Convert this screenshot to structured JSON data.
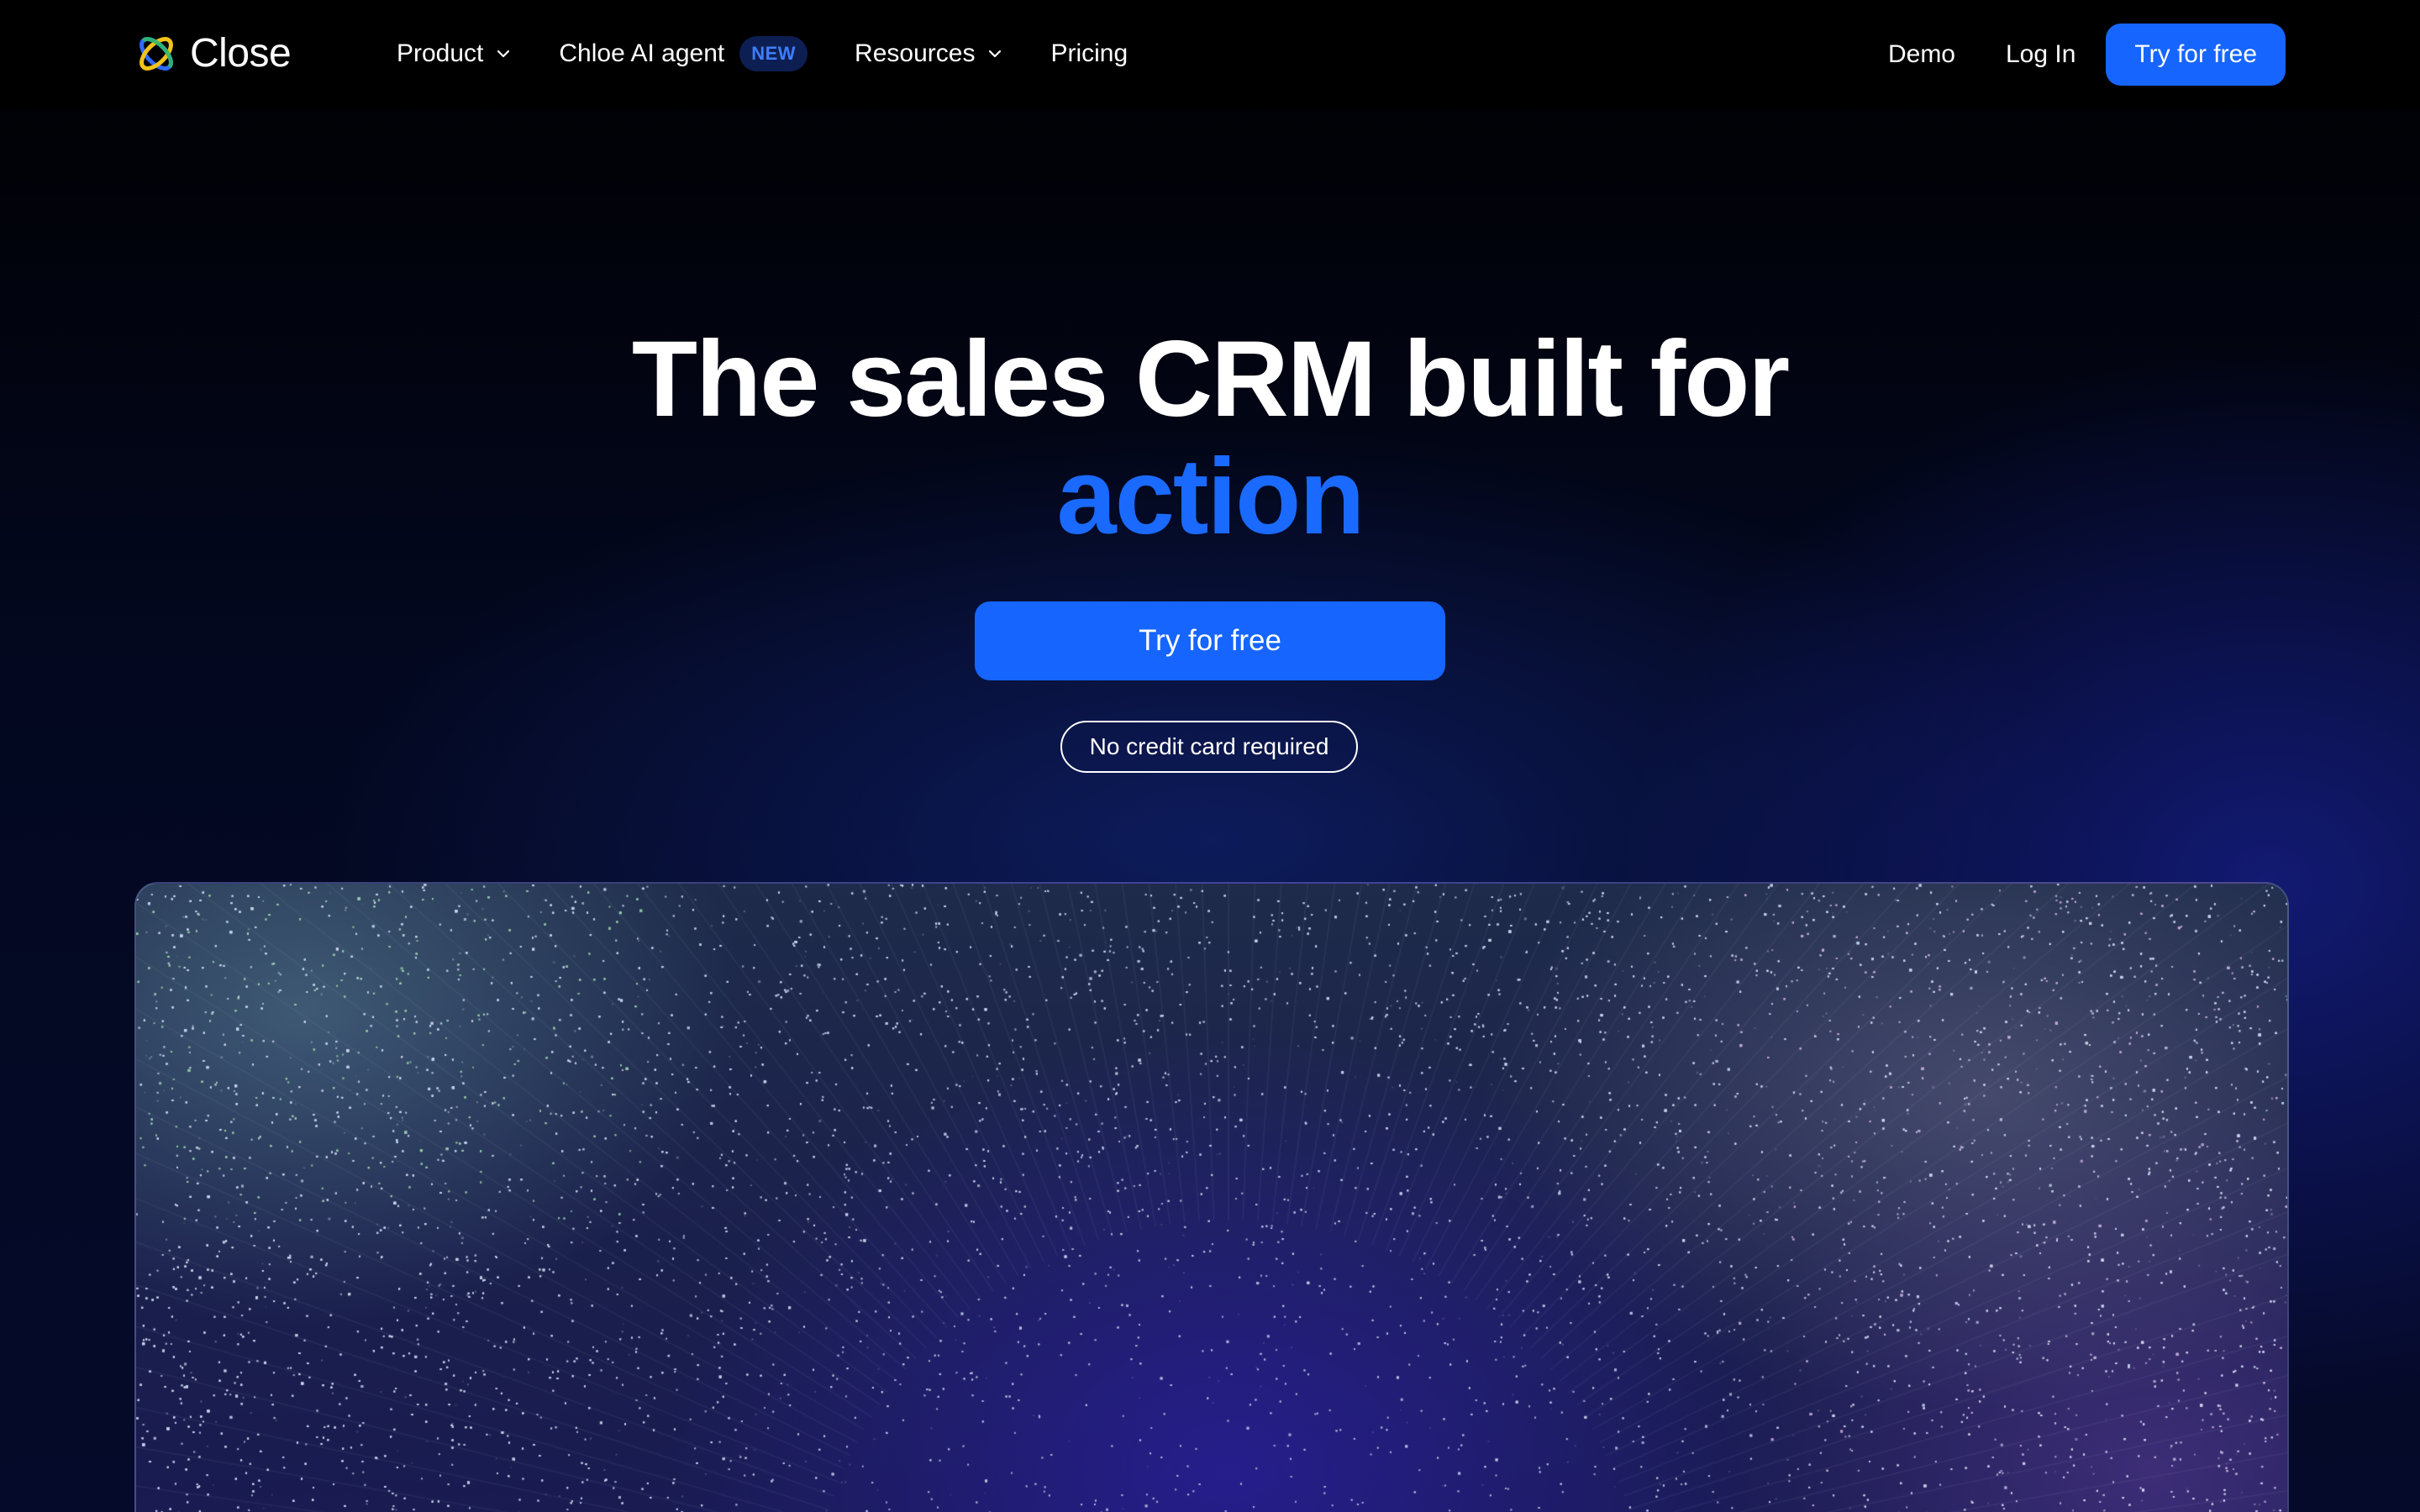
{
  "brand": {
    "name": "Close"
  },
  "nav": {
    "links": [
      {
        "label": "Product",
        "has_dropdown": true
      },
      {
        "label": "Chloe AI agent",
        "badge": "NEW"
      },
      {
        "label": "Resources",
        "has_dropdown": true
      },
      {
        "label": "Pricing"
      }
    ],
    "right": {
      "demo": "Demo",
      "login": "Log In",
      "cta": "Try for free"
    }
  },
  "hero": {
    "title_line1": "The sales CRM built for",
    "title_accent": "action",
    "cta": "Try for free",
    "note": "No credit card required"
  },
  "colors": {
    "accent": "#1665ff",
    "accent_text": "#1a6aff",
    "badge_bg": "#0d1f52",
    "badge_text": "#3f7dff",
    "background": "#000000"
  },
  "icons": {
    "logo": "close-logo-icon",
    "dropdown": "chevron-down-icon"
  }
}
